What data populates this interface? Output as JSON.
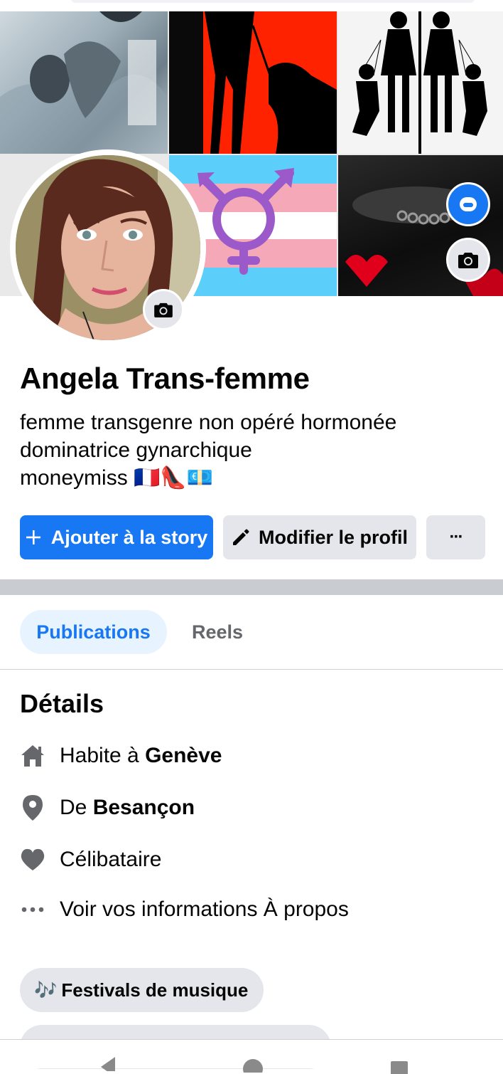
{
  "profile": {
    "name": "Angela Trans-femme",
    "bio_line1": "femme transgenre non opéré hormonée",
    "bio_line2": "dominatrice gynarchique",
    "bio_line3": "moneymiss 🇫🇷👠💶"
  },
  "actions": {
    "add_story": "Ajouter à la story",
    "edit_profile": "Modifier le profil",
    "more": "···"
  },
  "tabs": [
    {
      "label": "Publications",
      "active": true
    },
    {
      "label": "Reels",
      "active": false
    }
  ],
  "details": {
    "title": "Détails",
    "lives_prefix": "Habite à ",
    "lives_city": "Genève",
    "from_prefix": "De ",
    "from_city": "Besançon",
    "relationship": "Célibataire",
    "about_link": "Voir vos informations À propos"
  },
  "interests": [
    {
      "label": "Festivals de musique",
      "emoji": "🎶"
    }
  ],
  "colors": {
    "accent": "#1877f2",
    "button_grey": "#e4e6eb",
    "tab_active_bg": "#e7f3ff",
    "icon_grey": "#65676b"
  }
}
